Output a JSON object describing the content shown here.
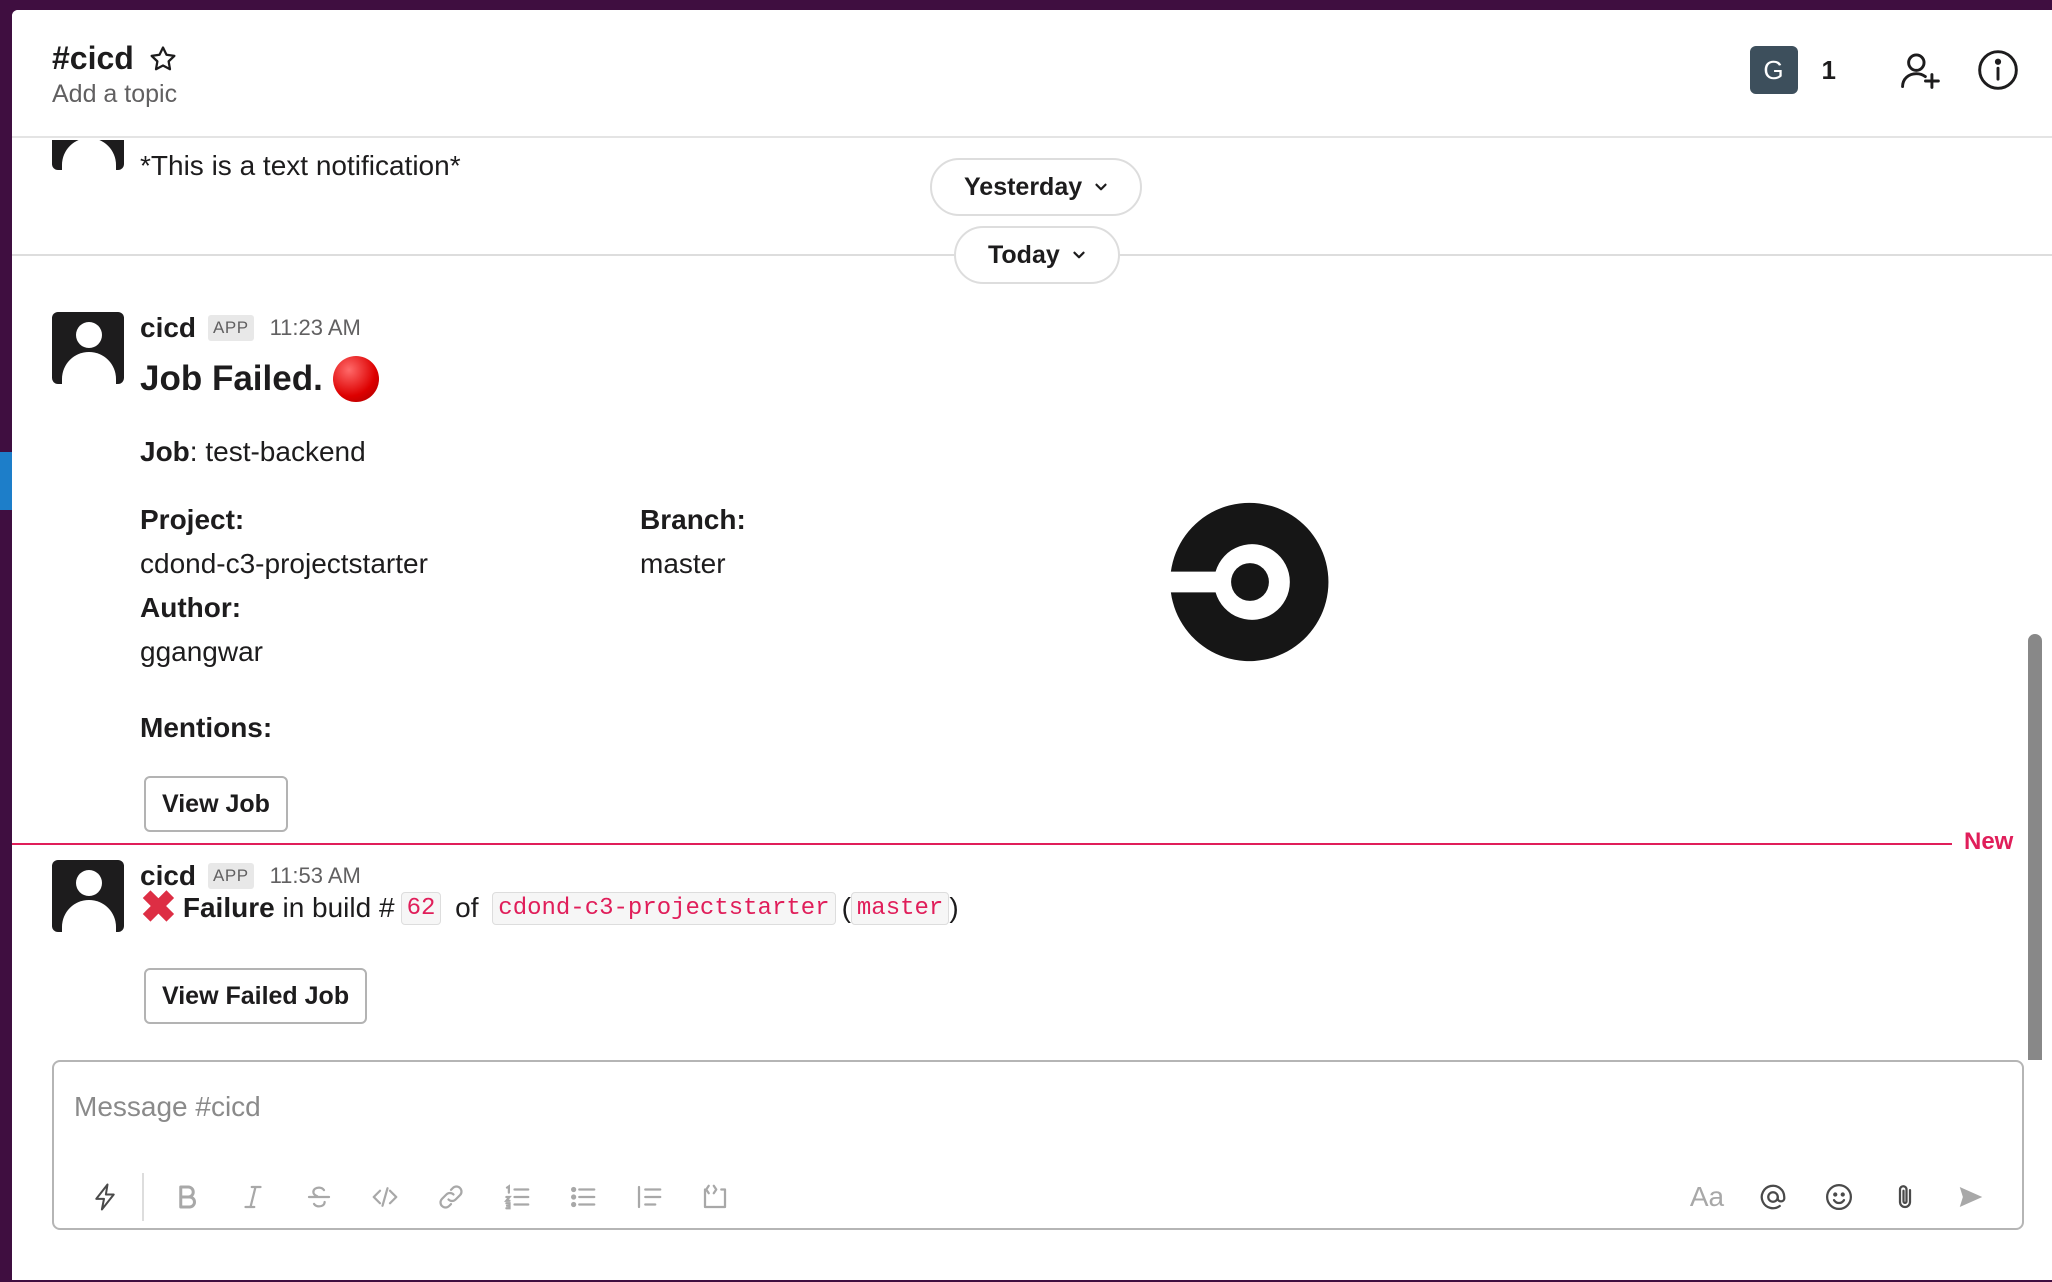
{
  "header": {
    "channel_name": "#cicd",
    "topic": "Add a topic",
    "member_initial": "G",
    "member_count": "1"
  },
  "dates": {
    "yesterday": "Yesterday",
    "today": "Today"
  },
  "previous_message": {
    "text": "*This is a text notification*"
  },
  "message1": {
    "sender": "cicd",
    "badge": "APP",
    "time": "11:23 AM",
    "title": "Job Failed.",
    "job_label": "Job",
    "job_value": ": test-backend",
    "project_label": "Project:",
    "project_value": "cdond-c3-projectstarter",
    "branch_label": "Branch:",
    "branch_value": "master",
    "author_label": "Author:",
    "author_value": "ggangwar",
    "mentions_label": "Mentions:",
    "button": "View Job"
  },
  "new_marker": "New",
  "message2": {
    "sender": "cicd",
    "badge": "APP",
    "time": "11:53 AM",
    "status": "Failure",
    "text_in_build": " in build #",
    "build_number": "62",
    "text_of": " of ",
    "project": "cdond-c3-projectstarter",
    "paren_open": "(",
    "branch": "master",
    "paren_close": ")",
    "button": "View Failed Job"
  },
  "composer": {
    "placeholder": "Message #cicd",
    "toolbar": [
      "shortcuts-icon",
      "bold-icon",
      "italic-icon",
      "strikethrough-icon",
      "code-icon",
      "link-icon",
      "ordered-list-icon",
      "bulleted-list-icon",
      "blockquote-icon",
      "code-block-icon",
      "format-icon",
      "mention-icon",
      "emoji-icon",
      "attach-icon",
      "send-icon"
    ],
    "format_label": "Aa"
  },
  "colors": {
    "sidebar": "#3f0e40",
    "accent_blue": "#1d7ec9",
    "new_marker": "#e01e5a",
    "code_text": "#e01e5a",
    "member_avatar": "#3d4f5c"
  }
}
